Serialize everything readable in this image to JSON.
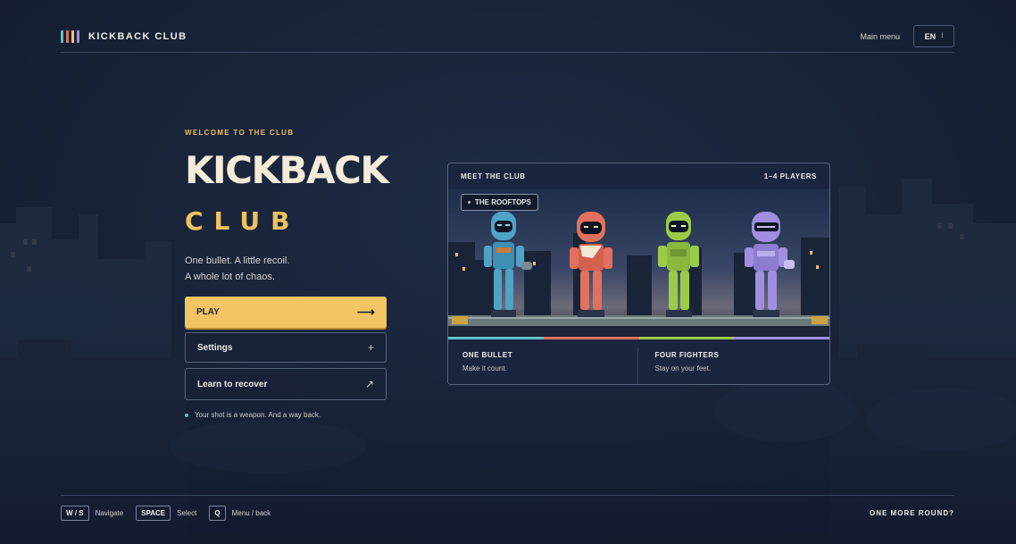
{
  "brand": {
    "name": "KICKBACK CLUB",
    "bar_colors": [
      "#5fc0c8",
      "#e2705e",
      "#f2c564",
      "#a08ee0"
    ]
  },
  "header": {
    "main_menu_label": "Main menu",
    "language": "EN",
    "language_icon": "chevron-down-icon"
  },
  "hero": {
    "eyebrow": "WELCOME TO THE CLUB",
    "title_line1": "KICKBACK",
    "title_line2": "CLUB",
    "tagline_line1": "One bullet. A little recoil.",
    "tagline_line2": "A whole lot of chaos."
  },
  "menu": {
    "play_label": "PLAY",
    "play_icon": "arrow-right-icon",
    "settings_label": "Settings",
    "settings_icon": "plus-icon",
    "learn_label": "Learn to recover",
    "learn_icon": "arrow-up-right-icon"
  },
  "hint": "Your shot is a weapon. And a way back.",
  "card": {
    "header_left": "MEET THE CLUB",
    "header_right": "1–4 PLAYERS",
    "location_badge": "THE ROOFTOPS",
    "stripe_colors": [
      "#5fc0c8",
      "#e2705e",
      "#9ccb4a",
      "#a08ee0"
    ],
    "features": [
      {
        "title": "ONE BULLET",
        "subtitle": "Make it count."
      },
      {
        "title": "FOUR FIGHTERS",
        "subtitle": "Stay on your feet."
      }
    ]
  },
  "footer": {
    "keys": [
      {
        "key": "W / S",
        "action": "Navigate"
      },
      {
        "key": "SPACE",
        "action": "Select"
      },
      {
        "key": "Q",
        "action": "Menu / back"
      }
    ],
    "tagline": "ONE MORE ROUND?"
  },
  "colors": {
    "accent": "#f2c564",
    "background": "#172236",
    "card": "#1a2540"
  }
}
